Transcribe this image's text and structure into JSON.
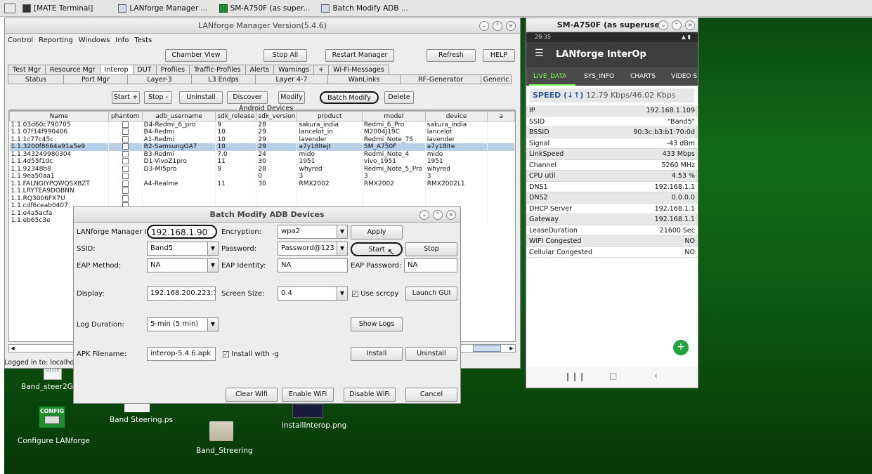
{
  "taskbar": {
    "items": [
      {
        "label": "[MATE Terminal]"
      },
      {
        "label": "LANforge Manager ..."
      },
      {
        "label": "SM-A750F (as super..."
      },
      {
        "label": "Batch Modify ADB ..."
      }
    ]
  },
  "manager": {
    "title": "LANforge Manager   Version(5.4.6)",
    "menu": [
      "Control",
      "Reporting",
      "Windows",
      "Info",
      "Tests"
    ],
    "toolbar": {
      "chamber_view": "Chamber View",
      "stop_all": "Stop All",
      "restart_manager": "Restart Manager",
      "refresh": "Refresh",
      "help": "HELP"
    },
    "tabs1": [
      "Test Mgr",
      "Resource Mgr",
      "Interop",
      "DUT",
      "Profiles",
      "Traffic-Profiles",
      "Alerts",
      "Warnings",
      "+",
      "Wi-Fi-Messages"
    ],
    "tabs2": [
      "Status",
      "Port Mgr",
      "Layer-3",
      "L3 Endps",
      "Layer 4-7",
      "WanLinks",
      "RF-Generator",
      "Generic"
    ],
    "actions": {
      "start": "Start +",
      "stop": "Stop -",
      "uninstall": "Uninstall",
      "discover": "Discover",
      "modify": "Modify",
      "batch_modify": "Batch Modify",
      "delete": "Delete"
    },
    "section_title": "Android Devices",
    "columns": [
      "Name",
      "phantom",
      "adb_username",
      "sdk_release",
      "sdk_version",
      "product",
      "model",
      "device",
      "a"
    ],
    "rows": [
      [
        "1.1.03d60c790705",
        "D4-Redmi_6_pro",
        "9",
        "28",
        "sakura_india",
        "Redmi_6_Pro",
        "sakura_india"
      ],
      [
        "1.1.07f14f990406",
        "B4-Redmi",
        "10",
        "29",
        "lancelot_in",
        "M2004J19C",
        "lancelot"
      ],
      [
        "1.1.1c77c45c",
        "A1-Redmi",
        "10",
        "29",
        "lavender",
        "Redmi_Note_7S",
        "lavender"
      ],
      [
        "1.1.3200f8664a91a5e9",
        "B2-SamsungGA7",
        "10",
        "29",
        "a7y18ltejt",
        "SM_A750F",
        "a7y18lte"
      ],
      [
        "1.1.343249980304",
        "B3-Redmi",
        "7.0",
        "24",
        "mido",
        "Redmi_Note_4",
        "mido"
      ],
      [
        "1.1.4d55f1dc",
        "D1-VivoZ1pro",
        "11",
        "30",
        "1951",
        "vivo_1951",
        "1951"
      ],
      [
        "1.1.92348b8",
        "D3-MI5pro",
        "9",
        "28",
        "whyred",
        "Redmi_Note_5_Pro",
        "whyred"
      ],
      [
        "1.1.9ea50aa1",
        "",
        "",
        "0",
        "3",
        "3",
        "3"
      ],
      [
        "1.1.FALNGIYPQWQSX8ZT",
        "A4-Realme",
        "11",
        "30",
        "RMX2002",
        "RMX2002",
        "RMX2002L1"
      ],
      [
        "1.1.LRYTEA9DOBNN",
        "",
        "",
        "",
        "",
        "",
        ""
      ],
      [
        "1.1.RQ3006FX7U",
        "",
        "",
        "",
        "",
        "",
        ""
      ],
      [
        "1.1.cdf6ceab0407",
        "",
        "",
        "",
        "",
        "",
        ""
      ],
      [
        "1.1.e4a5acfa",
        "",
        "",
        "",
        "",
        "",
        ""
      ],
      [
        "1.1.eb65c3e",
        "",
        "",
        "",
        "",
        "",
        ""
      ]
    ],
    "status": "Logged in to:  localhost"
  },
  "dialog": {
    "title": "Batch Modify ADB Devices",
    "labels": {
      "ip": "LANforge Manager IP:",
      "ssid": "SSID:",
      "eap_method": "EAP Method:",
      "display": "Display:",
      "log_duration": "Log Duration:",
      "apk": "APK Filename:",
      "encryption": "Encryption:",
      "password": "Password:",
      "eap_identity": "EAP Identity:",
      "screen_size": "Screen Size:",
      "eap_password": "EAP Password:"
    },
    "values": {
      "ip": "192.168.1.90",
      "ssid": "Band5",
      "eap_method": "NA",
      "display": "192.168.200.223:1",
      "log_duration": "5-min (5 min)",
      "apk": "interop-5.4.6.apk",
      "encryption": "wpa2",
      "password": "Password@123",
      "eap_identity": "NA",
      "screen_size": "0.4",
      "eap_password": "NA"
    },
    "checks": {
      "use_scrcpy": "Use scrcpy",
      "install_g": "Install with -g"
    },
    "buttons": {
      "apply": "Apply",
      "start": "Start",
      "stop": "Stop",
      "launch_gui": "Launch GUI",
      "show_logs": "Show Logs",
      "install": "Install",
      "uninstall": "Uninstall",
      "clear_wifi": "Clear Wifi",
      "enable_wifi": "Enable WiFi",
      "disable_wifi": "Disable WiFi",
      "cancel": "Cancel"
    }
  },
  "phone": {
    "title": "SM-A750F (as superuser)",
    "status_time": "20:35",
    "app_title": "LANforge InterOp",
    "tabs": [
      "LIVE_DATA",
      "SYS_INFO",
      "CHARTS",
      "VIDEO S"
    ],
    "speed_label": "SPEED (↓↑)",
    "speed_value": "12.79 Kbps/46.02 Kbps",
    "rows": [
      [
        "IP",
        "192.168.1.109"
      ],
      [
        "SSID",
        "\"Band5\""
      ],
      [
        "BSSID",
        "90:3c:b3:b1:70:0d"
      ],
      [
        "Signal",
        "-43 dBm"
      ],
      [
        "LinkSpeed",
        "433 Mbps"
      ],
      [
        "Channel",
        "5260 MHz"
      ],
      [
        "CPU util",
        "4.53 %"
      ],
      [
        "DNS1",
        "192.168.1.1"
      ],
      [
        "DNS2",
        "0.0.0.0"
      ],
      [
        "DHCP Server",
        "192.168.1.1"
      ],
      [
        "Gateway",
        "192.168.1.1"
      ],
      [
        "LeaseDuration",
        "21600 Sec"
      ],
      [
        "WIFI Congested",
        "NO"
      ],
      [
        "Cellular Congested",
        "NO"
      ]
    ],
    "fab": "+"
  },
  "desktop": {
    "icons": [
      {
        "label": "Band_steer2G.p"
      },
      {
        "label": "Configure LANforge"
      },
      {
        "label": "Band Steering.ps"
      },
      {
        "label": "Band_Streering"
      },
      {
        "label": "installInterop.png"
      }
    ],
    "config_text": "CONFIG",
    "binary_text": "01110"
  },
  "colors": {
    "accent_green": "#1f7a2d",
    "selected_row": "#b8cfe8",
    "phone_header": "#3d3d3d",
    "phone_tab_active": "#7cff4d"
  }
}
